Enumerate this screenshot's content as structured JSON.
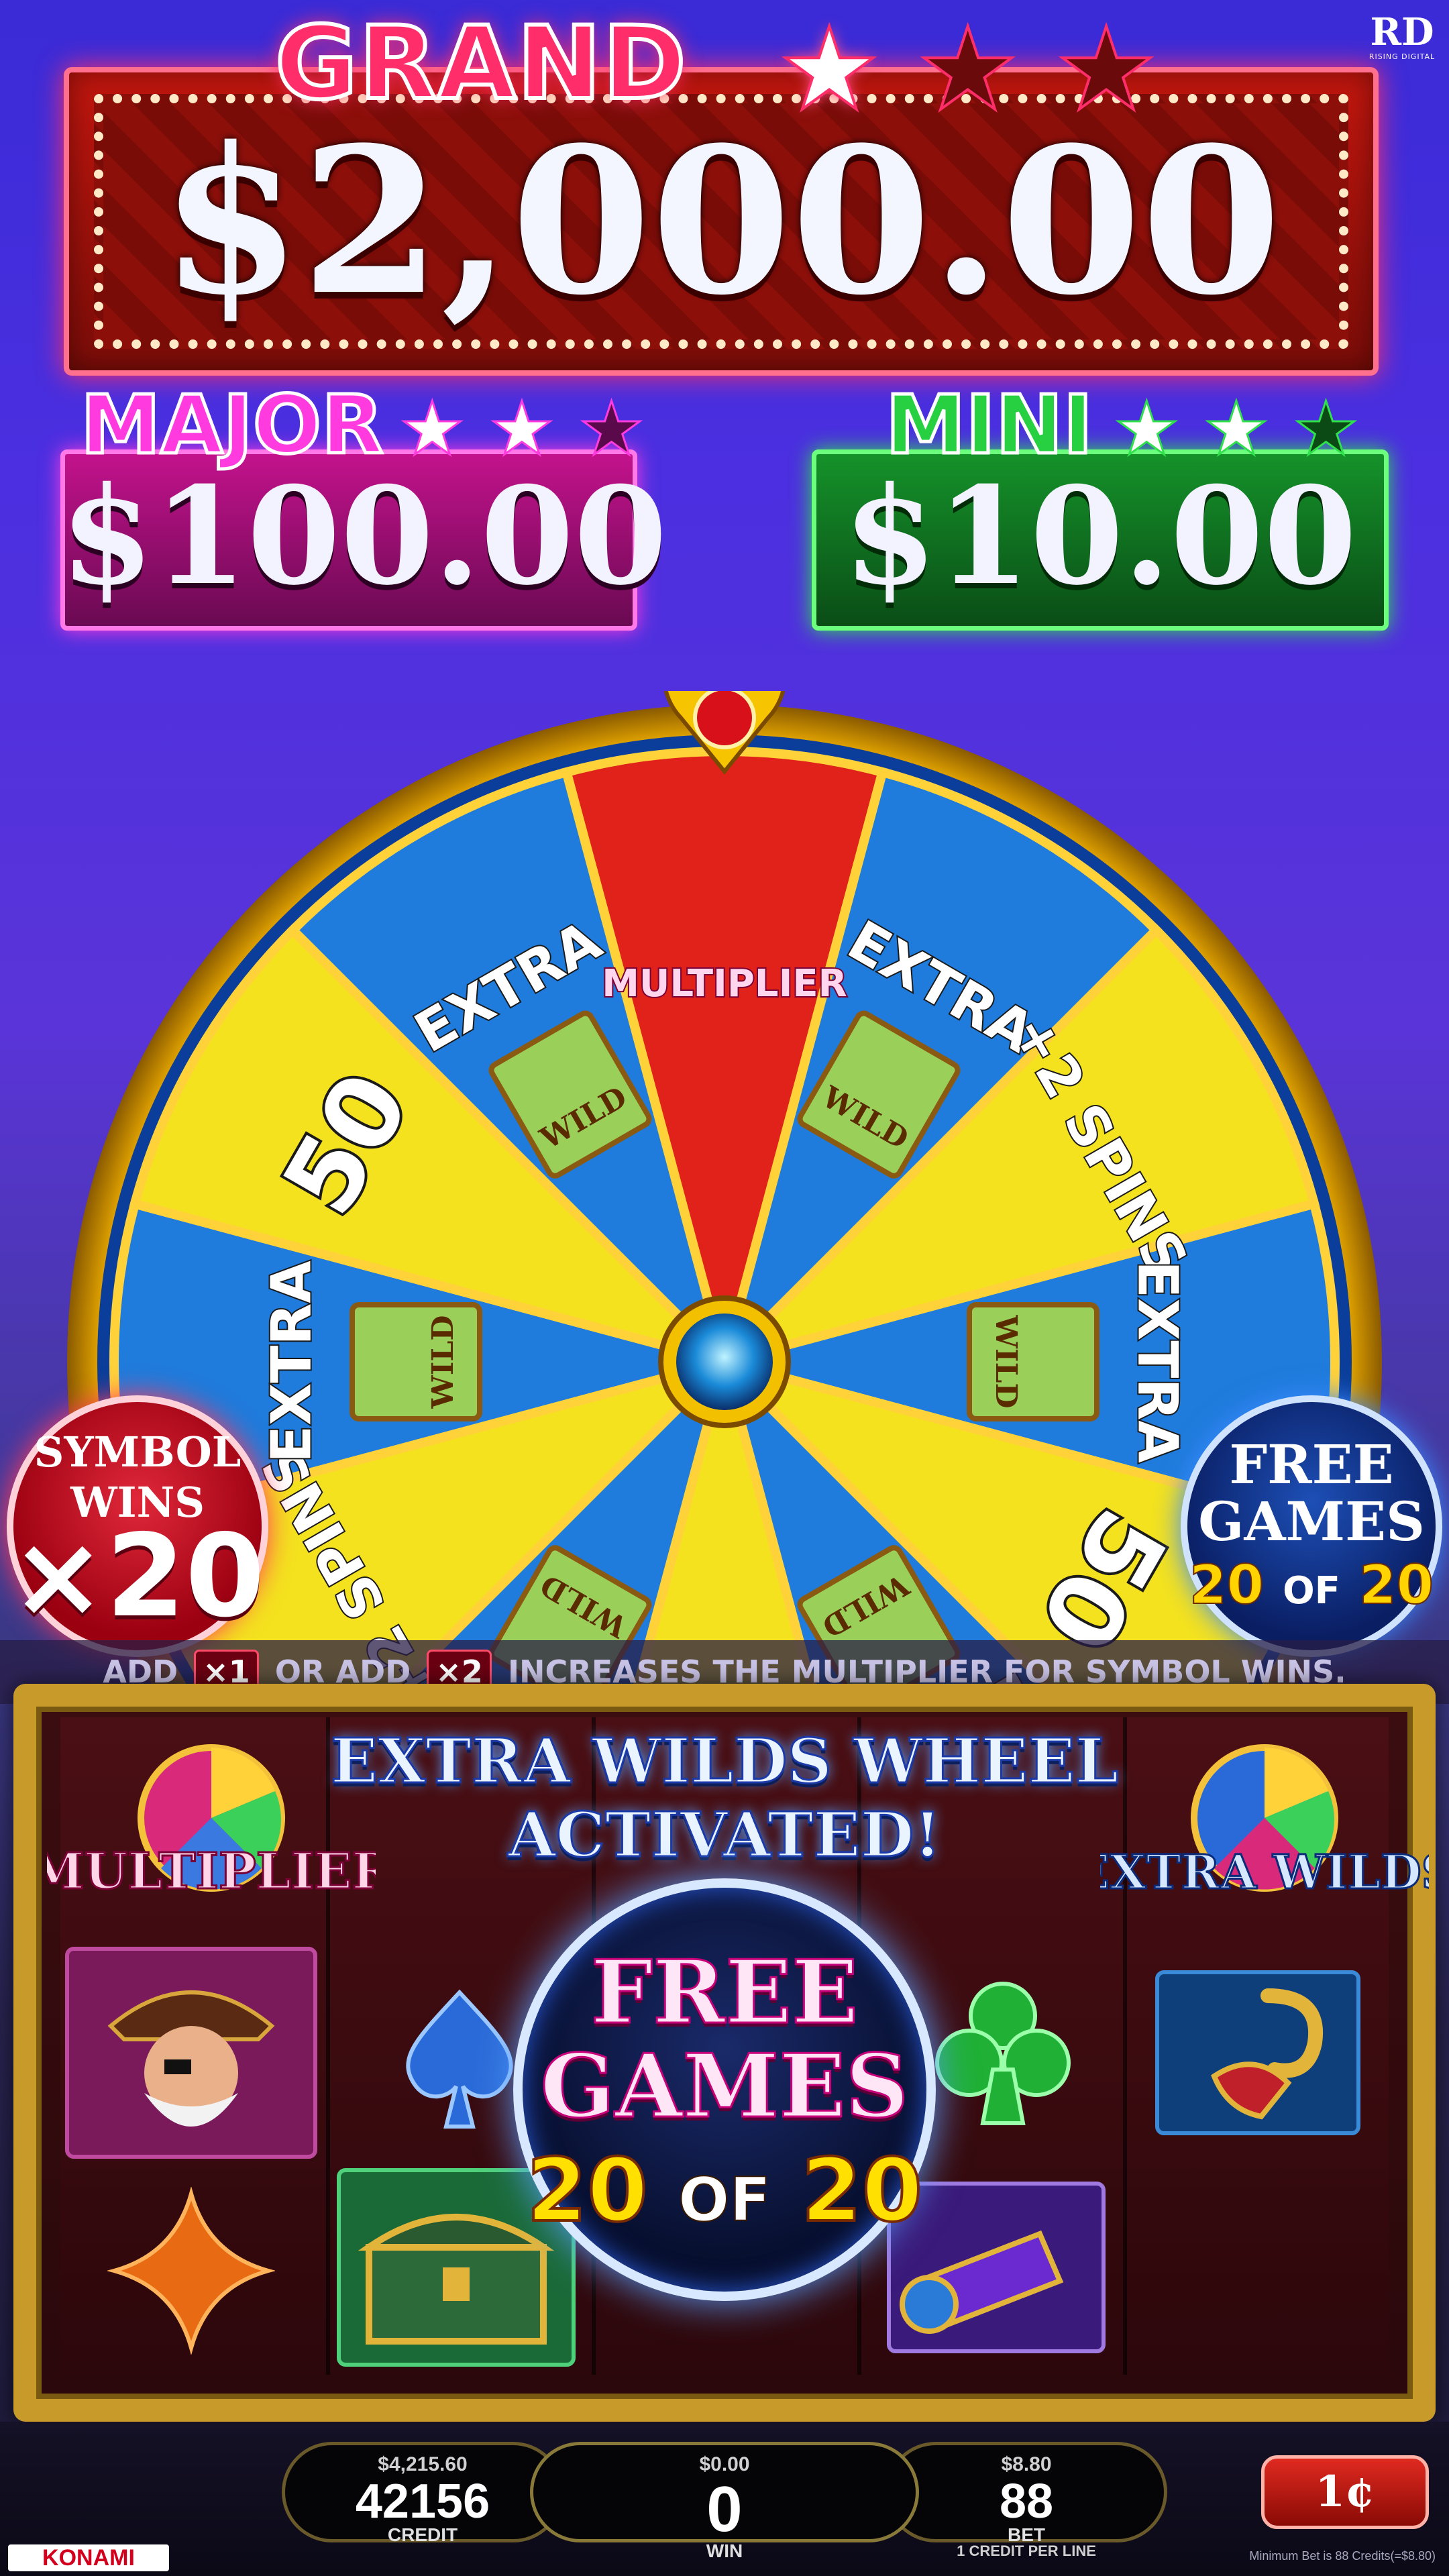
{
  "brand": {
    "logo_mark": "RD",
    "logo_text": "RISING DIGITAL",
    "konami": "KONAMI"
  },
  "jackpots": {
    "grand": {
      "title": "GRAND",
      "value": "$2,000.00",
      "stars_lit": 1,
      "stars_total": 3,
      "color": "#ff2d6a"
    },
    "major": {
      "title": "MAJOR",
      "value": "$100.00",
      "stars_lit": 2,
      "stars_total": 3,
      "color": "#ff3adf"
    },
    "mini": {
      "title": "MINI",
      "value": "$10.00",
      "stars_lit": 2,
      "stars_total": 3,
      "color": "#26d040"
    }
  },
  "wheel": {
    "pointer_icon": "ruby-pointer-icon",
    "hub_icon": "blue-gem-icon",
    "segments": [
      {
        "label": "MULTIPLIER",
        "kind": "multiplier",
        "color": "#e0221a"
      },
      {
        "label": "EXTRA",
        "kind": "wild",
        "color": "#1f7bdc"
      },
      {
        "label": "+2 SPINS",
        "kind": "spins",
        "color": "#f4e21e"
      },
      {
        "label": "EXTRA",
        "kind": "wild",
        "color": "#1f7bdc"
      },
      {
        "label": "50",
        "kind": "credits",
        "color": "#f4e21e"
      },
      {
        "label": "EXTRA",
        "kind": "wild",
        "color": "#1f7bdc"
      },
      {
        "label": "",
        "kind": "credits",
        "color": "#f4e21e"
      },
      {
        "label": "",
        "kind": "wild",
        "color": "#1f7bdc"
      },
      {
        "label": "+2 SPINS",
        "kind": "spins",
        "color": "#f4e21e"
      },
      {
        "label": "EXTRA",
        "kind": "wild",
        "color": "#1f7bdc"
      },
      {
        "label": "50",
        "kind": "credits",
        "color": "#f4e21e"
      },
      {
        "label": "EXTRA",
        "kind": "wild",
        "color": "#1f7bdc"
      }
    ],
    "wild_card_text": "WILD"
  },
  "symbol_wins": {
    "line1": "SYMBOL",
    "line2": "WINS",
    "multiplier": "×20"
  },
  "free_games_small": {
    "line1": "FREE",
    "line2": "GAMES",
    "current": "20",
    "of": "OF",
    "total": "20"
  },
  "info_strip": {
    "part1": "ADD",
    "chip1": "×1",
    "part2": "OR ADD",
    "chip2": "×2",
    "part3": "INCREASES THE MULTIPLIER FOR SYMBOL WINS."
  },
  "banner": {
    "line1": "EXTRA WILDS WHEEL",
    "line2": "ACTIVATED!"
  },
  "feature_logos": {
    "left": "MULTIPLIER",
    "right": "EXTRA WILDS"
  },
  "free_games_center": {
    "line1": "FREE",
    "line2": "GAMES",
    "current": "20",
    "of": "OF",
    "total": "20"
  },
  "reel_symbols": [
    "pirate-captain-icon",
    "spade-icon",
    "club-icon",
    "hook-icon",
    "diamond-icon",
    "treasure-chest-icon",
    "spyglass-icon"
  ],
  "meters": {
    "credit": {
      "money": "$4,215.60",
      "value": "42156",
      "label": "CREDIT"
    },
    "win": {
      "money": "$0.00",
      "value": "0",
      "label": "WIN"
    },
    "bet": {
      "money": "$8.80",
      "value": "88",
      "label": "BET",
      "note": "1 CREDIT PER LINE"
    }
  },
  "denomination": "1¢",
  "min_bet_note": "Minimum Bet is 88 Credits(=$8.80)"
}
